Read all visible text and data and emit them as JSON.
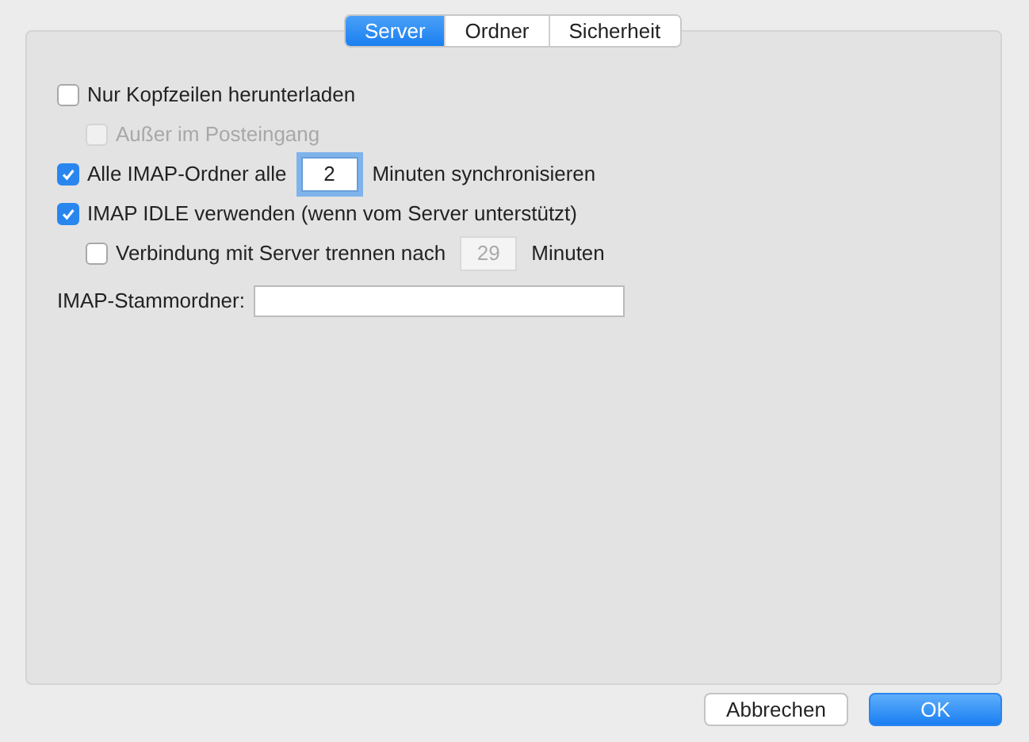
{
  "tabs": [
    {
      "label": "Server",
      "selected": true
    },
    {
      "label": "Ordner",
      "selected": false
    },
    {
      "label": "Sicherheit",
      "selected": false
    }
  ],
  "options": [
    {
      "label": "Nur Kopfzeilen herunterladen",
      "checked": false,
      "disabled": false,
      "children": [
        {
          "label": "Außer im Posteingang",
          "checked": false,
          "disabled": true
        }
      ]
    },
    {
      "label": "Alle IMAP-Ordner alle",
      "checked": true,
      "disabled": false,
      "field": {
        "value": "2",
        "disabled": false,
        "focused": true
      },
      "suffix": "Minuten synchronisieren"
    },
    {
      "label": "IMAP IDLE verwenden (wenn vom Server unterstützt)",
      "checked": true,
      "disabled": false,
      "children": [
        {
          "label": "Verbindung mit Server trennen nach",
          "checked": false,
          "disabled": false,
          "field": {
            "value": "29",
            "disabled": true,
            "focused": false
          },
          "suffix": "Minuten"
        }
      ]
    }
  ],
  "root_folder": {
    "label": "IMAP-Stammordner:"
  },
  "buttons": [
    {
      "label": "Abbrechen",
      "kind": "secondary"
    },
    {
      "label": "OK",
      "kind": "default"
    }
  ]
}
